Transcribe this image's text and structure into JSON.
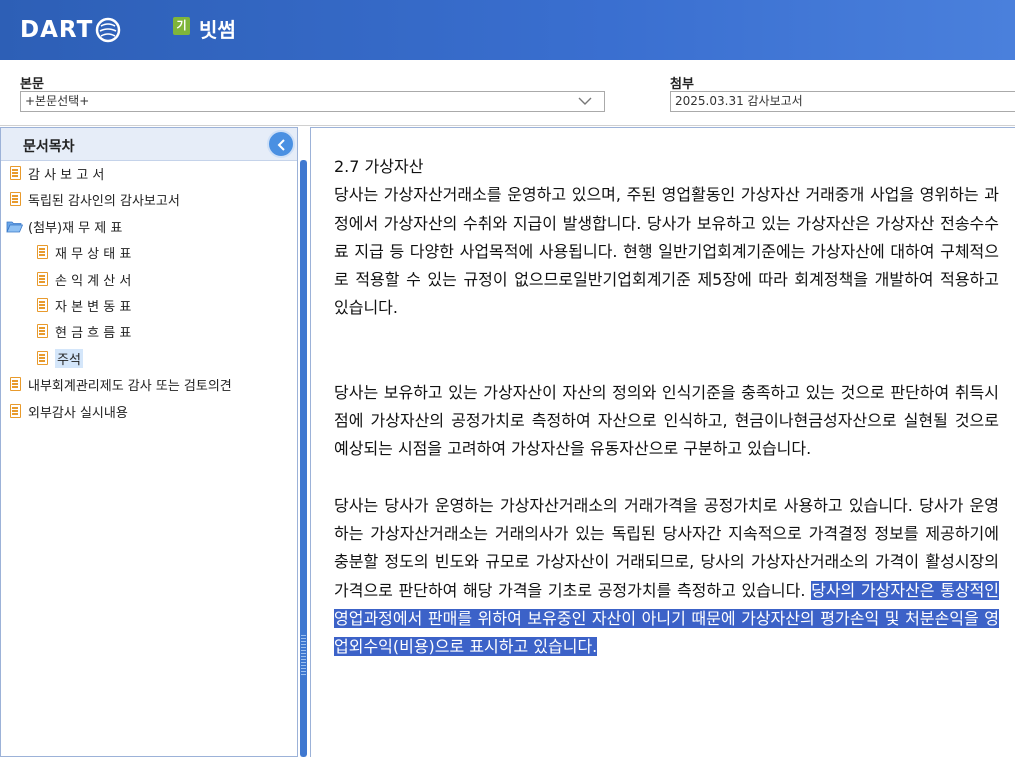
{
  "header": {
    "logo_text": "DART",
    "corp_badge": "기",
    "corp_name": "빗썸"
  },
  "toolbar": {
    "main_label": "본문",
    "main_select_value": "+본문선택+",
    "attach_label": "첨부",
    "attach_select_value": "2025.03.31  감사보고서"
  },
  "sidebar": {
    "title": "문서목차",
    "items": [
      {
        "label": "감 사 보 고 서"
      },
      {
        "label": "독립된 감사인의 감사보고서"
      },
      {
        "label": "(첨부)재 무 제 표"
      },
      {
        "label": "재 무 상 태 표"
      },
      {
        "label": "손 익 계 산 서"
      },
      {
        "label": "자 본 변 동 표"
      },
      {
        "label": "현 금 흐 름 표"
      },
      {
        "label": "주석"
      },
      {
        "label": "내부회계관리제도 감사 또는 검토의견"
      },
      {
        "label": "외부감사 실시내용"
      }
    ]
  },
  "content": {
    "heading": "2.7 가상자산",
    "para1": "당사는 가상자산거래소를 운영하고 있으며, 주된 영업활동인 가상자산 거래중개 사업을 영위하는 과정에서 가상자산의 수취와 지급이 발생합니다. 당사가 보유하고 있는 가상자산은 가상자산 전송수수료 지급 등 다양한 사업목적에 사용됩니다. 현행 일반기업회계기준에는 가상자산에 대하여 구체적으로 적용할 수 있는 규정이 없으므로일반기업회계기준 제5장에 따라 회계정책을 개발하여 적용하고 있습니다.",
    "para2": "당사는 보유하고 있는 가상자산이 자산의 정의와 인식기준을 충족하고 있는 것으로 판단하여 취득시점에 가상자산의 공정가치로 측정하여 자산으로 인식하고, 현금이나현금성자산으로 실현될 것으로 예상되는 시점을 고려하여 가상자산을 유동자산으로 구분하고 있습니다.",
    "para3": "당사는 당사가 운영하는 가상자산거래소의 거래가격을 공정가치로 사용하고 있습니다. 당사가 운영하는 가상자산거래소는 거래의사가 있는 독립된 당사자간  지속적으로 가격결정 정보를 제공하기에 충분할 정도의 빈도와 규모로 가상자산이 거래되므로, 당사의 가상자산거래소의 가격이 활성시장의 가격으로 판단하여 해당 가격을 기초로 공정가치를 측정하고 있습니다. ",
    "para3_highlight": "당사의 가상자산은 통상적인 영업과정에서 판매를 위하여 보유중인 자산이 아니기 때문에 가상자산의 평가손익 및 처분손익을 영업외수익(비용)으로 표시하고 있습니다."
  }
}
